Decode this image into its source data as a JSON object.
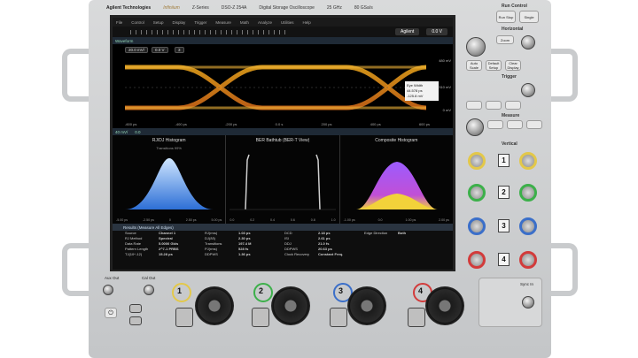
{
  "header": {
    "brand": "Agilent Technologies",
    "series_name": "Infiniium",
    "series": "Z-Series",
    "model": "DSO-Z 254A",
    "description": "Digital Storage Oscilloscope",
    "bandwidth": "25 GHz",
    "sample_rate": "80 GSa/s"
  },
  "menu": [
    "File",
    "Control",
    "Setup",
    "Display",
    "Trigger",
    "Measure",
    "Math",
    "Analyze",
    "Utilities",
    "Help"
  ],
  "run_state": "Agilent",
  "scale_readout": "0.0 V",
  "waveform": {
    "section_label": "Waveform",
    "ch_scale": "20.0 mV/",
    "offset": "0.0 V",
    "marker": "3",
    "right_labels": [
      "480 mV",
      "310 mV",
      "0 mV"
    ],
    "xticks": [
      "-600 ps",
      "-400 ps",
      "-200 ps",
      "0.0 s",
      "200 ps",
      "400 ps",
      "600 ps"
    ],
    "measurement": {
      "title": "Eye Width",
      "value": "44.578 ps",
      "second_value": "-125.8 mV"
    }
  },
  "lower_toolbar": {
    "scale": "40 mV/",
    "offset": "0.0"
  },
  "histograms": [
    {
      "title": "RJ/DJ Histogram",
      "note": "Transitions 99%",
      "axis": [
        "-5.00 ps",
        "-2.50 ps",
        "0",
        "2.50 ps",
        "5.00 ps"
      ]
    },
    {
      "title": "BER Bathtub (BER-T View)",
      "note": "",
      "axis": [
        "0.0",
        "0.2",
        "0.4",
        "0.6",
        "0.8",
        "1.0"
      ]
    },
    {
      "title": "Composite Histogram",
      "note": "",
      "axis": [
        "-1.00 ps",
        "0.0",
        "1.00 ps",
        "2.00 ps"
      ]
    }
  ],
  "results": {
    "header": "Results  (Measure All Edges)",
    "col1": [
      [
        "Source",
        "Channel 1"
      ],
      [
        "RJ Method",
        "Spectral"
      ],
      [
        "Data Rate",
        "5.0000 Gb/s"
      ],
      [
        "Pattern Length",
        "2^7-1 PRBS"
      ],
      [
        "TJ(10^-12)",
        "15.28 ps"
      ]
    ],
    "col2": [
      [
        "RJ(rms)",
        "1.03 ps"
      ],
      [
        "DJ(δδ)",
        "2.30 ps"
      ],
      [
        "Transitions",
        "197.4 M"
      ],
      [
        "PJ(rms)",
        "528 fs"
      ],
      [
        "DDPWS",
        "1.36 ps"
      ]
    ],
    "col3": [
      [
        "DCD",
        "2.18 ps"
      ],
      [
        "ISI",
        "2.61 ps"
      ],
      [
        "DDJ",
        "21.0 fs"
      ],
      [
        "DDPWS",
        "20.63 ps"
      ],
      [
        "Clock Recovery",
        "Constant Freq."
      ]
    ],
    "col4": [
      [
        "Edge Direction",
        "Both"
      ]
    ]
  },
  "panel": {
    "run_control": "Run Control",
    "run_stop": "Run Stop",
    "single": "Single",
    "auto_scale": "Auto Scale",
    "default_setup": "Default Setup",
    "clear_display": "Clear Display",
    "horizontal": "Horizontal",
    "zoom": "Zoom",
    "trigger": "Trigger",
    "measure": "Measure",
    "vertical": "Vertical",
    "channels": [
      "1",
      "2",
      "3",
      "4"
    ]
  },
  "front": {
    "aux_out": "Aux Out",
    "cal_out": "Cal Out",
    "sync_in": "Sync In",
    "inputs": [
      "1",
      "2",
      "3",
      "4"
    ]
  },
  "colors": {
    "ch1": "#e3c84a",
    "ch2": "#3cb04a",
    "ch3": "#3b6fc9",
    "ch4": "#d23b3b"
  }
}
